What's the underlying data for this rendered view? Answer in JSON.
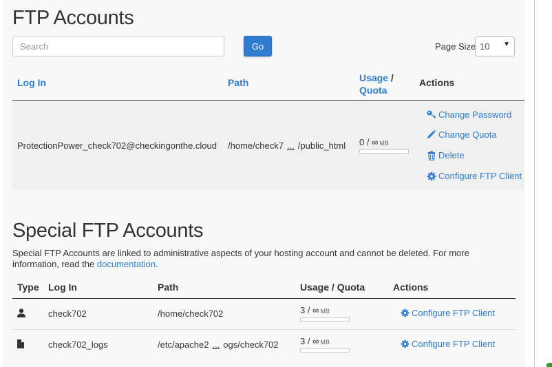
{
  "ftp_accounts": {
    "title": "FTP Accounts",
    "search_placeholder": "Search",
    "go_label": "Go",
    "page_size_label": "Page Size",
    "page_size_value": "10",
    "columns": {
      "login": "Log In",
      "path": "Path",
      "usage": "Usage",
      "usage_sep": "/",
      "quota": "Quota",
      "actions": "Actions"
    },
    "rows": [
      {
        "login": "ProtectionPower_check702@checkingonthe.cloud",
        "path_start": "/home/check7",
        "path_ellipsis": "...",
        "path_end": "/public_html",
        "usage": "0 / ∞",
        "usage_unit": "MB",
        "actions": {
          "change_password": "Change Password",
          "change_quota": "Change Quota",
          "delete": "Delete",
          "configure": "Configure FTP Client"
        }
      }
    ]
  },
  "special_ftp": {
    "title": "Special FTP Accounts",
    "description": "Special FTP Accounts are linked to administrative aspects of your hosting account and cannot be deleted. For more information, read the",
    "doc_link": "documentation",
    "doc_period": ".",
    "columns": {
      "type": "Type",
      "login": "Log In",
      "path": "Path",
      "usage": "Usage / Quota",
      "actions": "Actions"
    },
    "rows": [
      {
        "type_icon": "user-icon",
        "login": "check702",
        "path": "/home/check702",
        "usage": "3 / ∞",
        "usage_unit": "MB",
        "action": "Configure FTP Client"
      },
      {
        "type_icon": "file-icon",
        "login": "check702_logs",
        "path_start": "/etc/apache2",
        "path_ellipsis": "...",
        "path_end": "ogs/check702",
        "usage": "3 / ∞",
        "usage_unit": "MB",
        "action": "Configure FTP Client"
      }
    ]
  },
  "colors": {
    "link": "#2e7bcf",
    "button": "#2e7bcf",
    "panel": "#f8f8f8"
  }
}
